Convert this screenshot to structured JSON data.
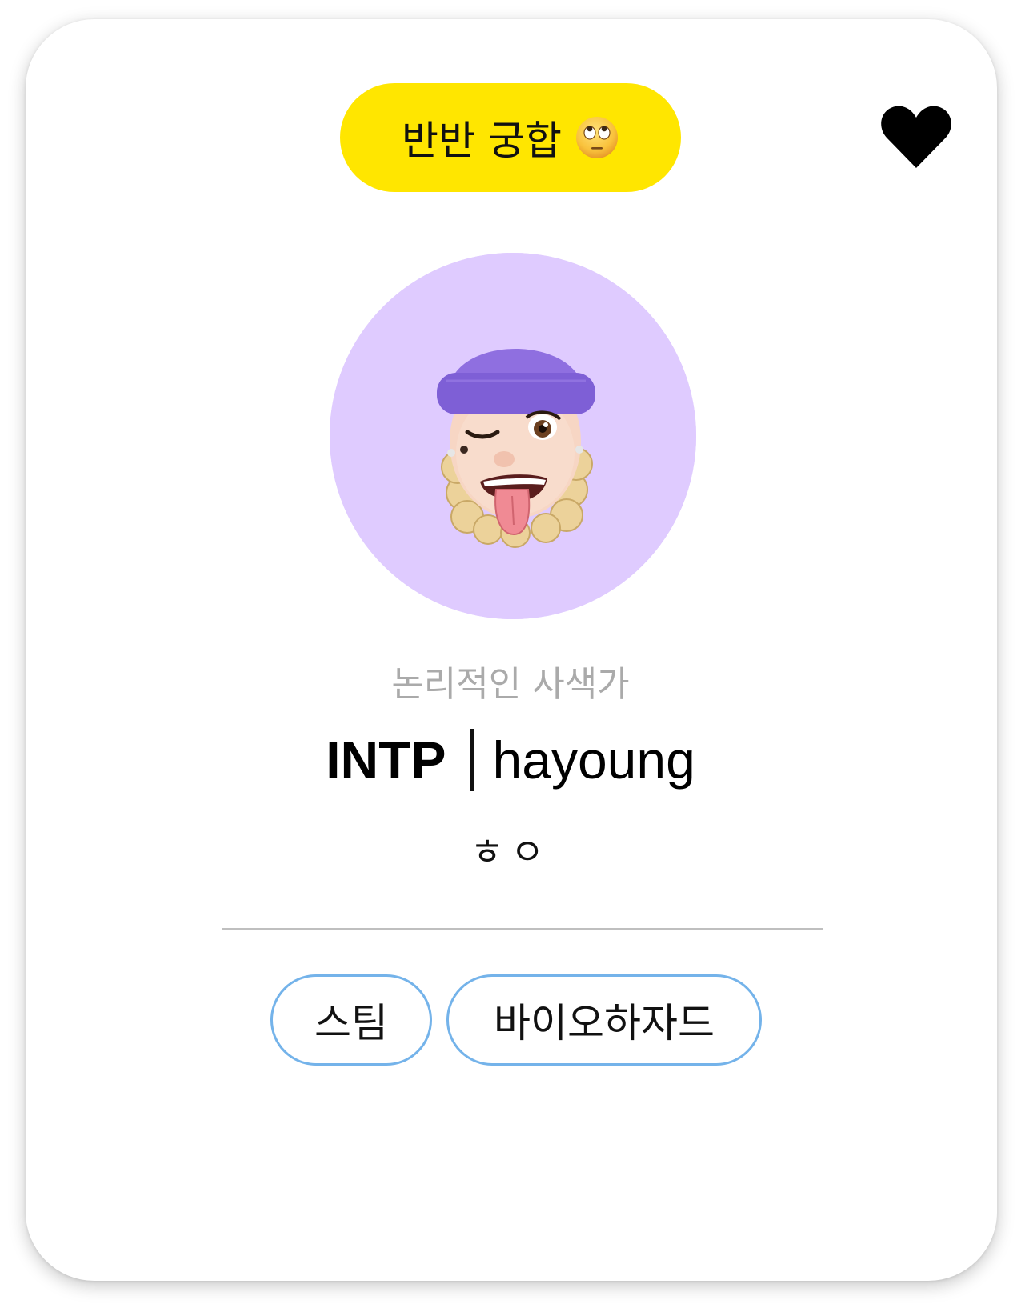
{
  "colors": {
    "badge_bg": "#ffe600",
    "avatar_bg": "#dfcbff",
    "tag_border": "#74b3ea",
    "heart": "#000000"
  },
  "match": {
    "label": "반반 궁합",
    "emoji_icon": "face-with-rolling-eyes-emoji"
  },
  "favorite": {
    "icon": "heart-icon"
  },
  "profile": {
    "avatar": "memoji-winking-tongue-out",
    "personality_title": "논리적인 사색가",
    "mbti": "INTP",
    "username": "hayoung",
    "status": "ㅎㅇ"
  },
  "tags": [
    "스팀",
    "바이오하자드"
  ]
}
